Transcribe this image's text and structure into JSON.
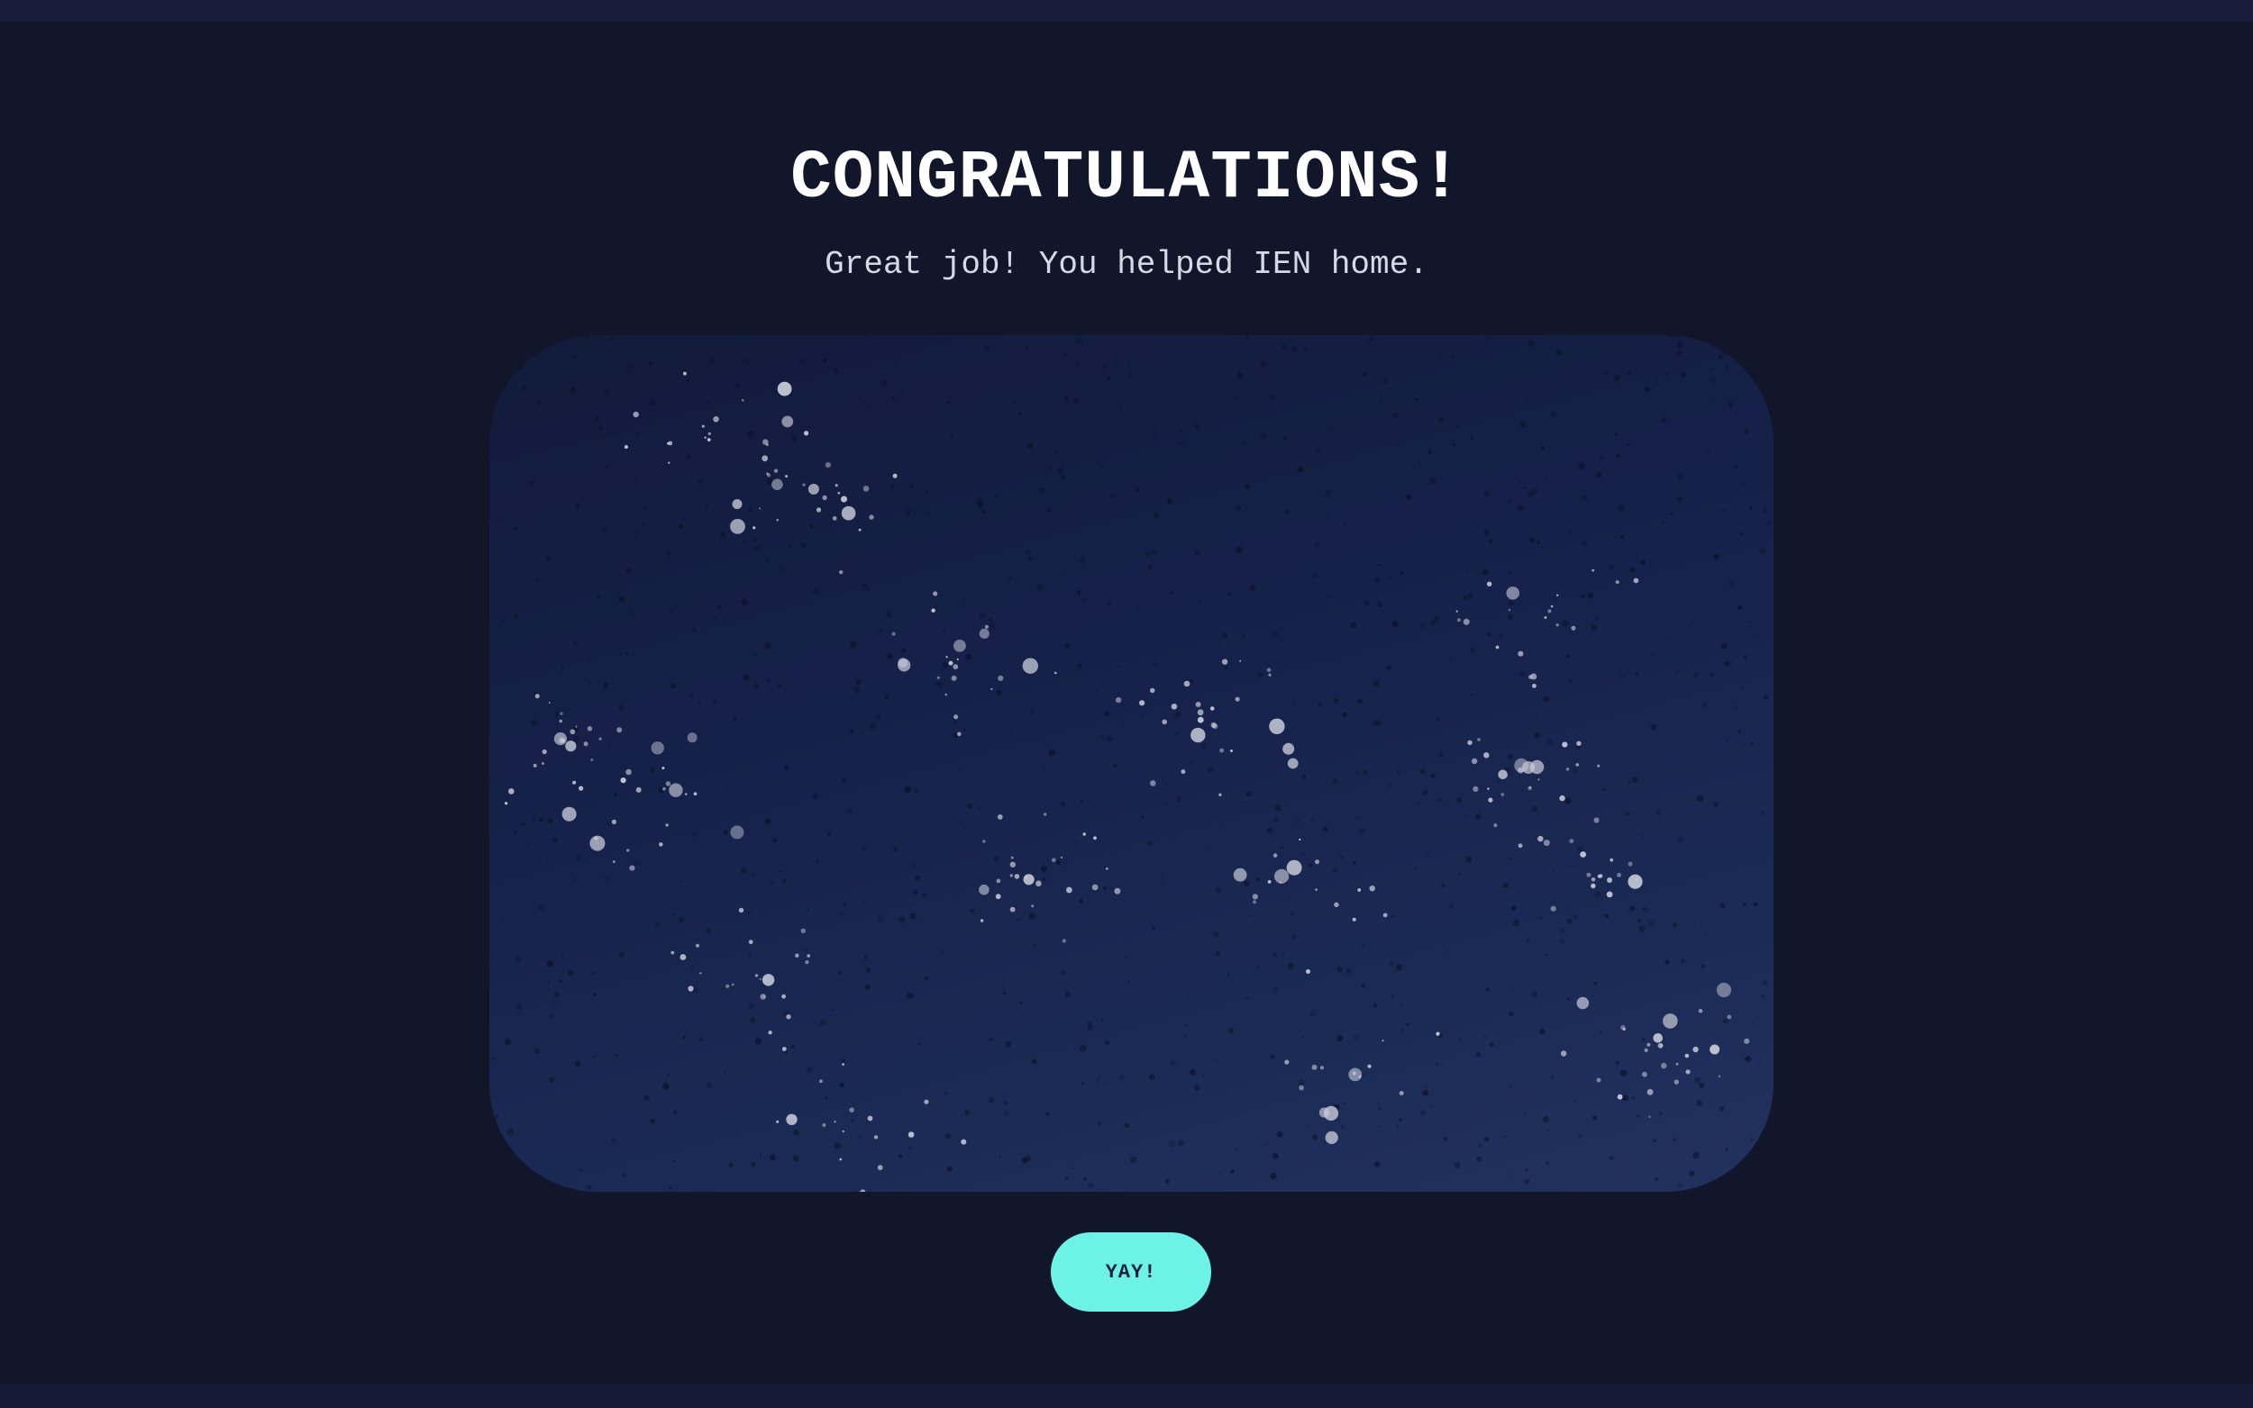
{
  "header": {
    "title": "CONGRATULATIONS!",
    "subtitle": "Great job! You helped IEN home."
  },
  "illustration": {
    "icon": "starry-night-sky-image"
  },
  "actions": {
    "confirm_label": "YAY!"
  },
  "colors": {
    "background": "#12162b",
    "accent": "#6df2e8",
    "title_text": "#ffffff",
    "subtitle_text": "#d6d8e3"
  }
}
